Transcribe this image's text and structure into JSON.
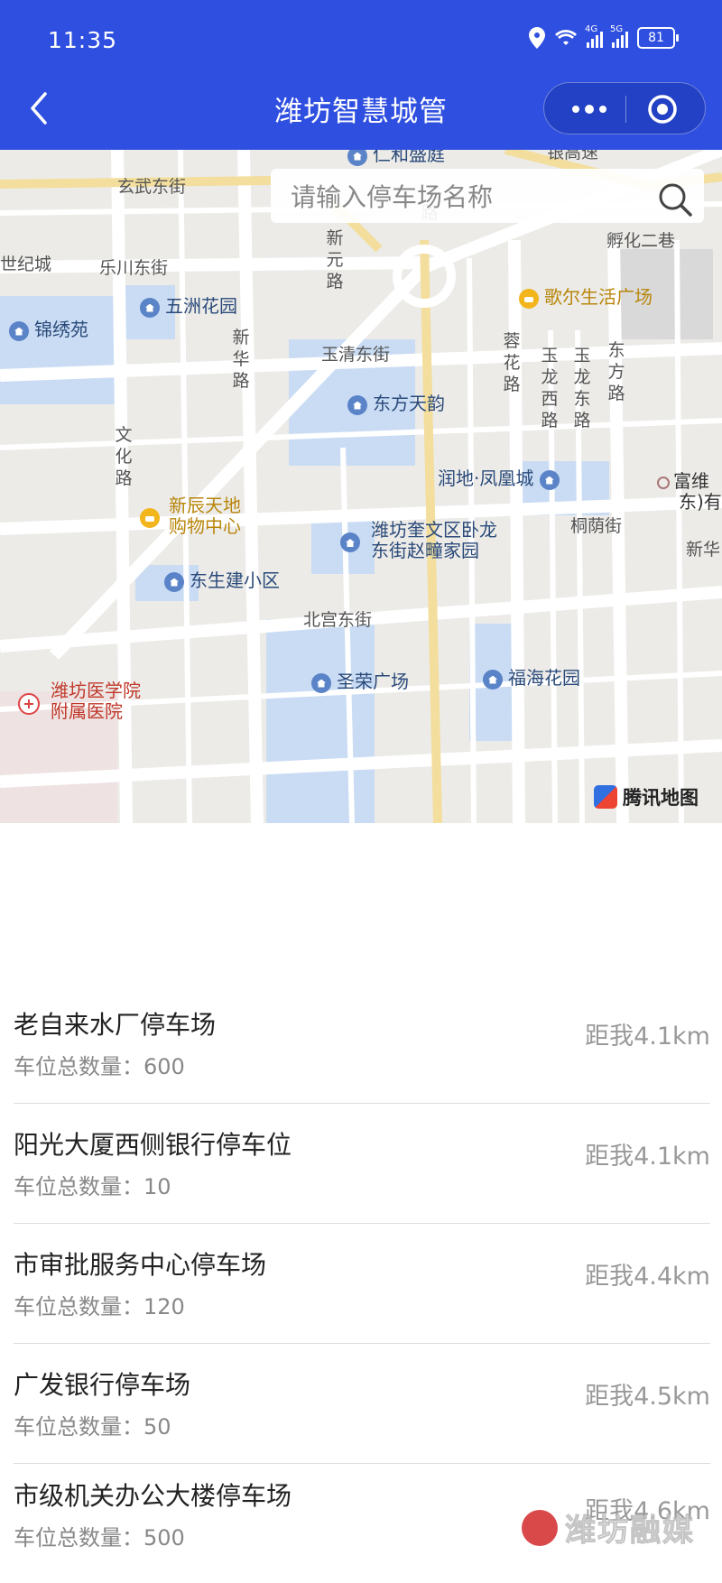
{
  "status_bar": {
    "time": "11:35",
    "net1": "4G",
    "net2": "5G",
    "battery": "81"
  },
  "header": {
    "title": "潍坊智慧城管"
  },
  "search": {
    "placeholder": "请输入停车场名称"
  },
  "map": {
    "pois": {
      "renhe": "仁和盛庭",
      "wuzhou": "五洲花园",
      "jinxiu": "锦绣苑",
      "geer": "歌尔生活广场",
      "dongfang": "东方天韵",
      "rundi": "润地·凤凰城",
      "fuwei": "富维",
      "fuwei2": "东)有",
      "xinchen": "新辰天地\n购物中心",
      "kuiwen": "潍坊奎文区卧龙\n东街赵疃家园",
      "dongsheng": "东生建小区",
      "shengrong": "圣荣广场",
      "fuhai": "福海花园",
      "hospital": "潍坊医学院\n附属医院"
    },
    "streets": {
      "xuanwu": "玄武东街",
      "shiji": "世纪城",
      "lechuan": "乐川东街",
      "fuhua": "孵化二巷",
      "yuqing": "玉清东街",
      "tongyin": "桐荫街",
      "xinhua": "新华",
      "beigong": "北宫东街",
      "xinhualu": "新华路",
      "wenhualu": "文化路",
      "ronghualu": "蓉花路",
      "yulongxi": "玉龙西路",
      "yulongdong": "玉龙东路",
      "dongfanglu": "东方路",
      "xinyuan": "新元路",
      "lu1": "路",
      "gaosu": "银高速"
    },
    "provider": "腾讯地图"
  },
  "list": {
    "items": [
      {
        "name": "老自来水厂停车场",
        "count": "车位总数量：600",
        "distance": "距我4.1km"
      },
      {
        "name": "阳光大厦西侧银行停车位",
        "count": "车位总数量：10",
        "distance": "距我4.1km"
      },
      {
        "name": "市审批服务中心停车场",
        "count": "车位总数量：120",
        "distance": "距我4.4km"
      },
      {
        "name": "广发银行停车场",
        "count": "车位总数量：50",
        "distance": "距我4.5km"
      },
      {
        "name": "市级机关办公大楼停车场",
        "count": "车位总数量：500",
        "distance": "距我4.6km"
      }
    ]
  },
  "watermark": "潍坊融媒"
}
